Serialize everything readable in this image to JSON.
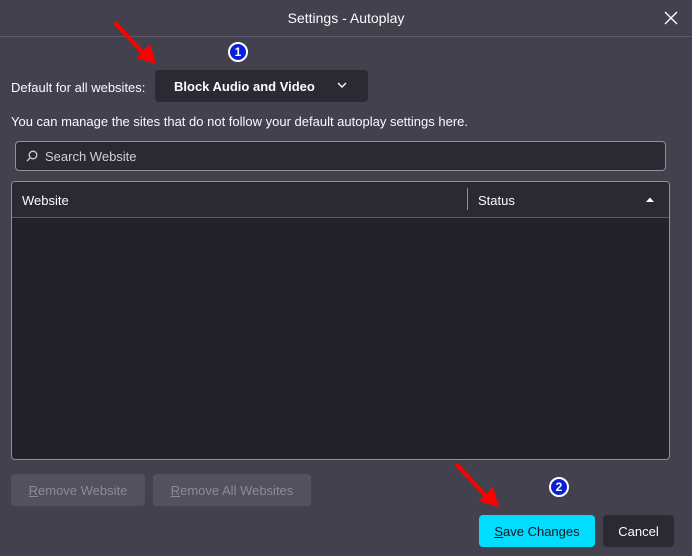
{
  "window": {
    "title": "Settings - Autoplay",
    "close_icon": "close-icon"
  },
  "default_setting": {
    "label": "Default for all websites:",
    "selected_value": "Block Audio and Video"
  },
  "description": "You can manage the sites that do not follow your default autoplay settings here.",
  "search": {
    "placeholder": "Search Website"
  },
  "table": {
    "columns": [
      "Website",
      "Status"
    ],
    "sort_direction": "ascending",
    "rows": []
  },
  "buttons": {
    "remove_website": {
      "first": "R",
      "rest": "emove Website"
    },
    "remove_all_websites": {
      "first": "R",
      "rest": "emove All Websites"
    },
    "save_changes": {
      "first": "S",
      "rest": "ave Changes"
    },
    "cancel": "Cancel"
  },
  "annotations": {
    "badge_1": "1",
    "badge_2": "2"
  },
  "colors": {
    "background": "#42414d",
    "accent": "#00ddff",
    "annotation_arrow": "#ff0000",
    "annotation_badge": "#0a1fd6"
  }
}
